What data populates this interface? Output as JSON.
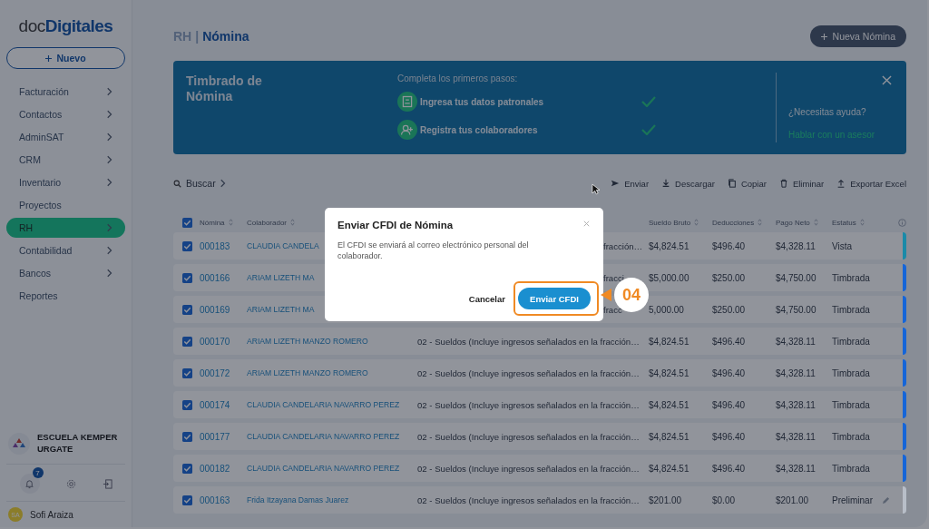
{
  "sidebar": {
    "logo": "doc**Digitales**",
    "new_button": "Nuevo",
    "items": [
      {
        "label": "Facturación",
        "has_submenu": true,
        "selected": false
      },
      {
        "label": "Contactos",
        "has_submenu": true,
        "selected": false
      },
      {
        "label": "AdminSAT",
        "has_submenu": true,
        "selected": false
      },
      {
        "label": "CRM",
        "has_submenu": true,
        "selected": false
      },
      {
        "label": "Inventario",
        "has_submenu": true,
        "selected": false
      },
      {
        "label": "Proyectos",
        "has_submenu": false,
        "selected": false
      },
      {
        "label": "RH",
        "has_submenu": true,
        "selected": true
      },
      {
        "label": "Contabilidad",
        "has_submenu": true,
        "selected": false
      },
      {
        "label": "Bancos",
        "has_submenu": true,
        "selected": false
      },
      {
        "label": "Reportes",
        "has_submenu": false,
        "selected": false
      }
    ],
    "company": "ESCUELA KEMPER URGATE",
    "notifications": "7",
    "user_initials": "SA",
    "user_name": "Sofi Araiza"
  },
  "header": {
    "section": "RH",
    "separator": "|",
    "title": "Nómina",
    "new_button": "Nueva Nómina"
  },
  "banner": {
    "title": "Timbrado de Nómina",
    "steps_heading": "Completa los primeros pasos:",
    "steps": [
      {
        "kind": "company",
        "label": "Ingresa tus datos patronales",
        "done": true
      },
      {
        "kind": "people",
        "label": "Registra tus colaboradores",
        "done": true
      }
    ],
    "help_text": "¿Necesitas ayuda?",
    "help_link": "Hablar con un asesor"
  },
  "toolbar": {
    "search": "Buscar",
    "actions": [
      {
        "kind": "send",
        "label": "Enviar"
      },
      {
        "kind": "download",
        "label": "Descargar"
      },
      {
        "kind": "copy",
        "label": "Copiar"
      },
      {
        "kind": "delete",
        "label": "Eliminar"
      },
      {
        "kind": "export",
        "label": "Exportar Excel"
      }
    ]
  },
  "table": {
    "select_all_checked": true,
    "columns": [
      "Nómina",
      "Colaborador",
      "Sueldo Bruto",
      "Deducciones",
      "Pago Neto",
      "Estatus"
    ],
    "rows": [
      {
        "checked": true,
        "nomina": "000183",
        "colaborador": "CLAUDIA CANDELA",
        "concepto": "fracción…",
        "bruto": "$4,824.51",
        "deducciones": "$496.40",
        "neto": "$4,328.11",
        "estatus": "Vista",
        "color": "#1a8aa8",
        "editable": false
      },
      {
        "checked": true,
        "nomina": "000166",
        "colaborador": "ARIAM LIZETH MA",
        "concepto": "fracci",
        "bruto": "$5,000.00",
        "deducciones": "$250.00",
        "neto": "$4,750.00",
        "estatus": "Timbrada",
        "color": "#1565d8",
        "editable": false
      },
      {
        "checked": true,
        "nomina": "000169",
        "colaborador": "ARIAM LIZETH MA",
        "concepto": "fracc",
        "bruto": "5,000.00",
        "deducciones": "$250.00",
        "neto": "$4,750.00",
        "estatus": "Timbrada",
        "color": "#1565d8",
        "editable": false
      },
      {
        "checked": true,
        "nomina": "000170",
        "colaborador": "ARIAM LIZETH MANZO ROMERO",
        "concepto": "02 - Sueldos (Incluye ingresos señalados en la fracción…",
        "bruto": "$4,824.51",
        "deducciones": "$496.40",
        "neto": "$4,328.11",
        "estatus": "Timbrada",
        "color": "#1565d8",
        "editable": false
      },
      {
        "checked": true,
        "nomina": "000172",
        "colaborador": "ARIAM LIZETH MANZO ROMERO",
        "concepto": "02 - Sueldos (Incluye ingresos señalados en la fracción…",
        "bruto": "$4,824.51",
        "deducciones": "$496.40",
        "neto": "$4,328.11",
        "estatus": "Timbrada",
        "color": "#1565d8",
        "editable": false
      },
      {
        "checked": true,
        "nomina": "000174",
        "colaborador": "CLAUDIA CANDELARIA NAVARRO PEREZ",
        "concepto": "02 - Sueldos (Incluye ingresos señalados en la fracción…",
        "bruto": "$4,824.51",
        "deducciones": "$496.40",
        "neto": "$4,328.11",
        "estatus": "Timbrada",
        "color": "#1565d8",
        "editable": false
      },
      {
        "checked": true,
        "nomina": "000177",
        "colaborador": "CLAUDIA CANDELARIA NAVARRO PEREZ",
        "concepto": "02 - Sueldos (Incluye ingresos señalados en la fracción…",
        "bruto": "$4,824.51",
        "deducciones": "$496.40",
        "neto": "$4,328.11",
        "estatus": "Timbrada",
        "color": "#1565d8",
        "editable": false
      },
      {
        "checked": true,
        "nomina": "000182",
        "colaborador": "CLAUDIA CANDELARIA NAVARRO PEREZ",
        "concepto": "02 - Sueldos (Incluye ingresos señalados en la fracción…",
        "bruto": "$4,824.51",
        "deducciones": "$496.40",
        "neto": "$4,328.11",
        "estatus": "Timbrada",
        "color": "#1565d8",
        "editable": false
      },
      {
        "checked": true,
        "nomina": "000163",
        "colaborador": "Frida Itzayana Damas Juarez",
        "concepto": "02 - Sueldos (Incluye ingresos señalados en la fracción…",
        "bruto": "$201.00",
        "deducciones": "$0.00",
        "neto": "$201.00",
        "estatus": "Preliminar",
        "color": "#b8bec8",
        "editable": true
      }
    ]
  },
  "dialog": {
    "title": "Enviar CFDI de Nómina",
    "message": "El CFDI se enviará al correo electrónico personal del colaborador.",
    "cancel": "Cancelar",
    "confirm": "Enviar CFDI"
  },
  "callout": {
    "label": "04"
  }
}
